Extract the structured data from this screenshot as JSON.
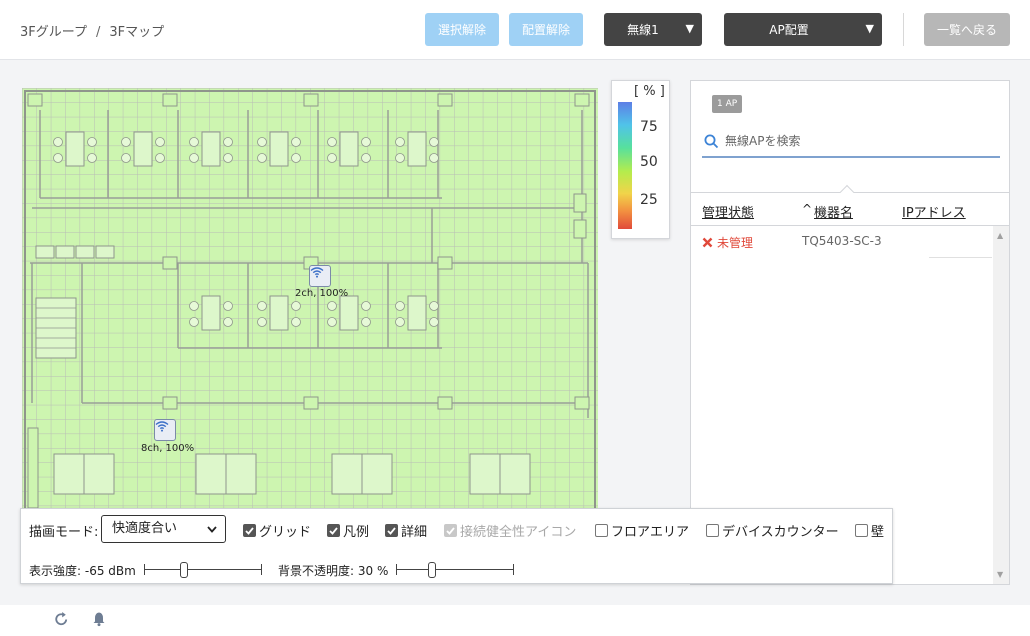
{
  "header": {
    "breadcrumb": [
      "3Fグループ",
      "3Fマップ"
    ],
    "breadcrumb_sep": "/",
    "buttons": {
      "deselect": "選択解除",
      "unplace": "配置解除",
      "wireless": "無線1",
      "ap_place": "AP配置",
      "back": "一覧へ戻る"
    }
  },
  "map": {
    "aps": [
      {
        "label": "2ch, 100%",
        "icon": "wifi-icon"
      },
      {
        "label": "8ch, 100%",
        "icon": "wifi-icon"
      }
    ],
    "colors": {
      "heat": "#cdf5b0",
      "grid": "#b7b7b7",
      "wall": "#9a9a9a"
    }
  },
  "legend": {
    "unit": "[ % ]",
    "ticks": [
      "75",
      "50",
      "25"
    ]
  },
  "panel": {
    "ap_count": "1 AP",
    "search_placeholder": "無線APを検索",
    "columns": {
      "status": "管理状態",
      "sort_indicator": "^",
      "device": "機器名",
      "ip": "IPアドレス"
    },
    "rows": [
      {
        "status": "未管理",
        "device": "TQ5403-SC-3"
      }
    ]
  },
  "controls": {
    "draw_mode_label": "描画モード:",
    "draw_mode_value": "快適度合い",
    "checkboxes": {
      "grid": {
        "label": "グリッド",
        "checked": true
      },
      "legend": {
        "label": "凡例",
        "checked": true
      },
      "detail": {
        "label": "詳細",
        "checked": true
      },
      "health": {
        "label": "接続健全性アイコン",
        "checked": true
      },
      "floor_area": {
        "label": "フロアエリア",
        "checked": false
      },
      "device_counter": {
        "label": "デバイスカウンター",
        "checked": false
      },
      "wall": {
        "label": "壁",
        "checked": false
      }
    },
    "strength_label": "表示強度: -65 dBm",
    "opacity_label": "背景不透明度: 30 %"
  },
  "footer": {
    "icons": [
      "refresh-icon",
      "bell-icon"
    ]
  }
}
